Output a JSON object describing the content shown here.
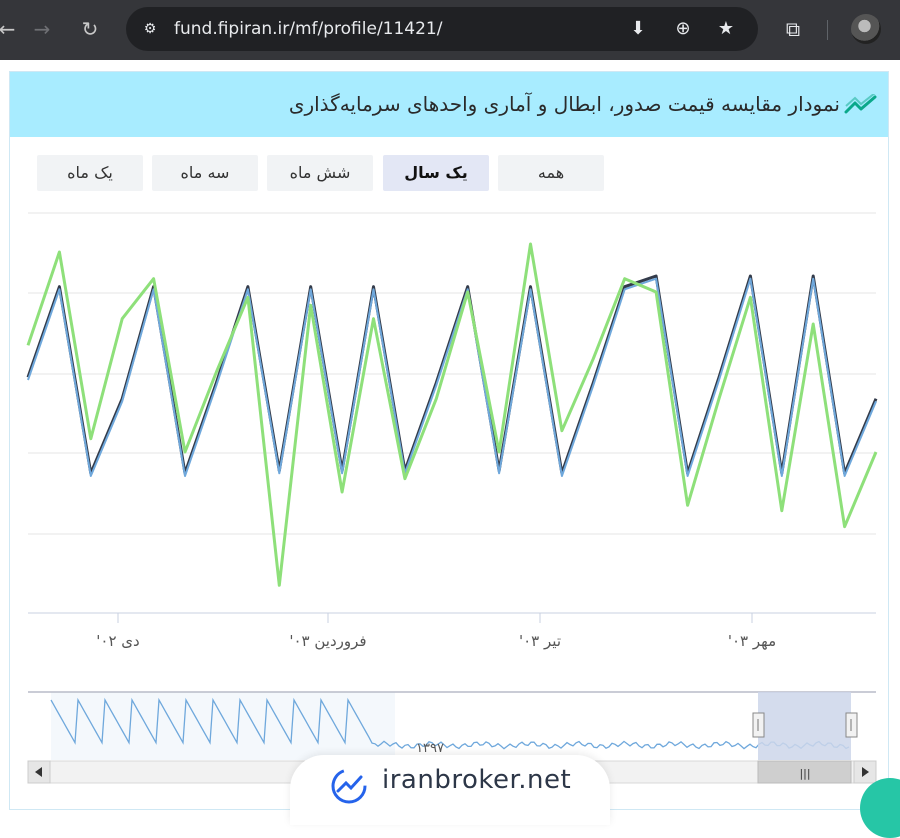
{
  "browser": {
    "url": "fund.fipiran.ir/mf/profile/11421/",
    "back_icon": "arrow-left",
    "forward_icon": "arrow-right",
    "reload_icon": "reload",
    "install_icon": "install-app",
    "zoom_icon": "magnifier-plus",
    "bookmark_icon": "star",
    "extensions_icon": "puzzle"
  },
  "card": {
    "title": "نمودار مقایسه قیمت صدور، ابطال و آماری واحدهای سرمایه‌گذاری",
    "header_bg": "#a8ecff",
    "range_buttons": [
      "همه",
      "یک سال",
      "شش ماه",
      "سه ماه",
      "یک ماه"
    ],
    "active_range": "یک سال"
  },
  "chart_data": {
    "type": "line",
    "title": "",
    "xlabel": "",
    "ylabel": "",
    "x_ticks": [
      "دی ۰۲'",
      "فروردین ۰۳'",
      "تیر ۰۳'",
      "مهر ۰۳'"
    ],
    "grid": true,
    "series": [
      {
        "color": "#333b4a",
        "values": [
          48,
          82,
          12,
          40,
          82,
          12,
          46,
          82,
          13,
          82,
          13,
          82,
          13,
          46,
          82,
          13,
          82,
          12,
          46,
          82,
          86,
          12,
          48,
          86,
          12,
          86,
          12,
          40
        ]
      },
      {
        "color": "#6fa8dc",
        "values": [
          47,
          81,
          11,
          39,
          81,
          11,
          45,
          81,
          12,
          81,
          12,
          81,
          12,
          45,
          81,
          12,
          81,
          11,
          45,
          81,
          85,
          11,
          47,
          85,
          11,
          85,
          11,
          39
        ]
      },
      {
        "color": "#8ee07a",
        "values": [
          60,
          95,
          25,
          70,
          85,
          20,
          50,
          78,
          -30,
          75,
          5,
          70,
          10,
          40,
          80,
          20,
          98,
          28,
          55,
          85,
          80,
          0,
          40,
          78,
          -2,
          68,
          -8,
          20
        ]
      }
    ]
  },
  "navigator": {
    "label": "۱۳۹۷",
    "bg_left": "#f4f8fc",
    "selection_color": "#cdd6ea",
    "scroll_handle": "|||"
  },
  "watermark": {
    "text": "iranbroker.net"
  }
}
